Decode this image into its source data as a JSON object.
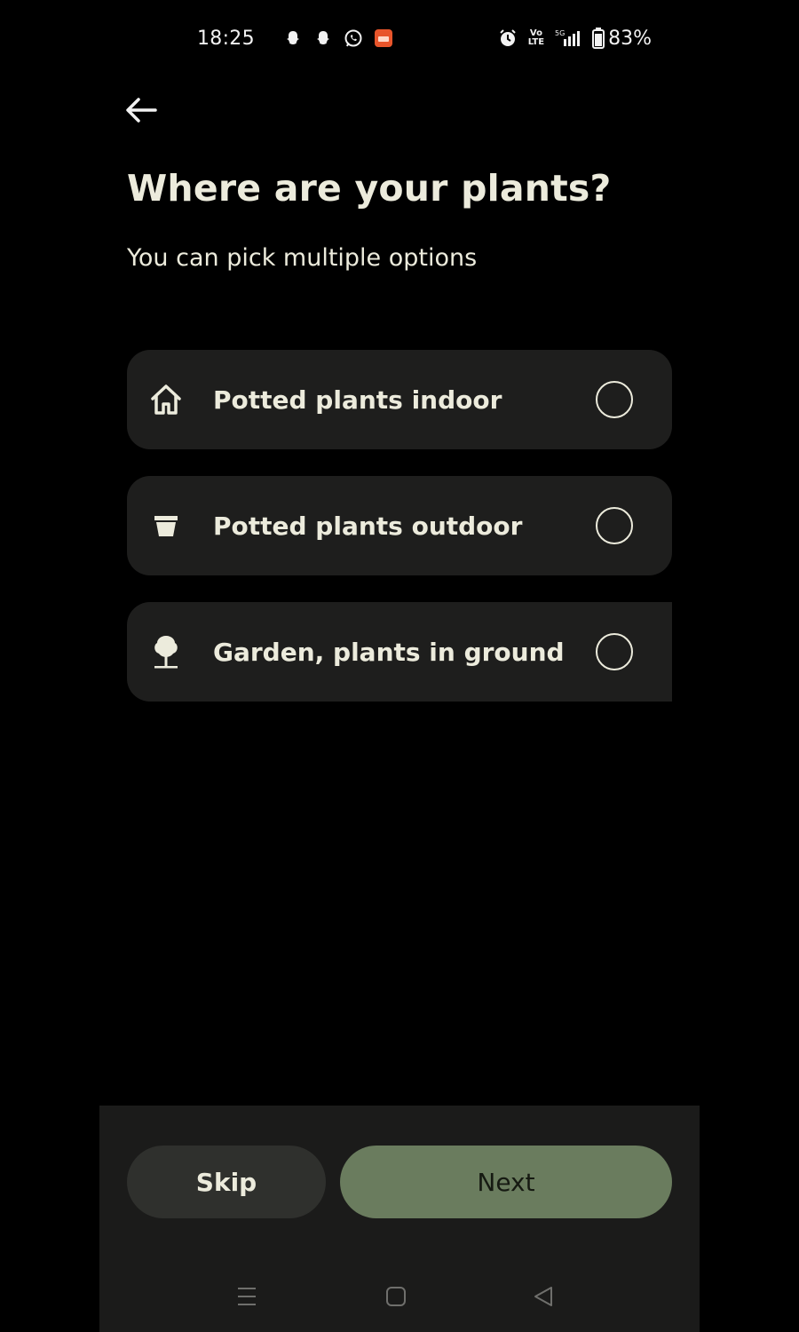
{
  "status_bar": {
    "time": "18:25",
    "battery": "83%",
    "network": "5G",
    "volte": "Vo LTE",
    "icons": [
      "snapchat-icon",
      "snapchat-icon",
      "whatsapp-icon",
      "app-notification-icon",
      "alarm-icon",
      "volte-icon",
      "signal-icon",
      "battery-icon"
    ]
  },
  "header": {
    "back_icon": "arrow-left-icon",
    "title": "Where are your plants?",
    "subtitle": "You can pick multiple options"
  },
  "options": [
    {
      "label": "Potted plants indoor",
      "icon": "house-icon",
      "selected": false
    },
    {
      "label": "Potted plants outdoor",
      "icon": "flower-pot-icon",
      "selected": false
    },
    {
      "label": "Garden, plants in ground",
      "icon": "tree-icon",
      "selected": false
    }
  ],
  "footer": {
    "skip_label": "Skip",
    "next_label": "Next"
  },
  "nav_bar": {
    "icons": [
      "recent-apps-icon",
      "home-icon",
      "back-icon"
    ]
  },
  "colors": {
    "background": "#000000",
    "card": "#1e1e1d",
    "text": "#ecebdc",
    "accent": "#6a7c5e",
    "secondary_button": "#2f302d"
  }
}
